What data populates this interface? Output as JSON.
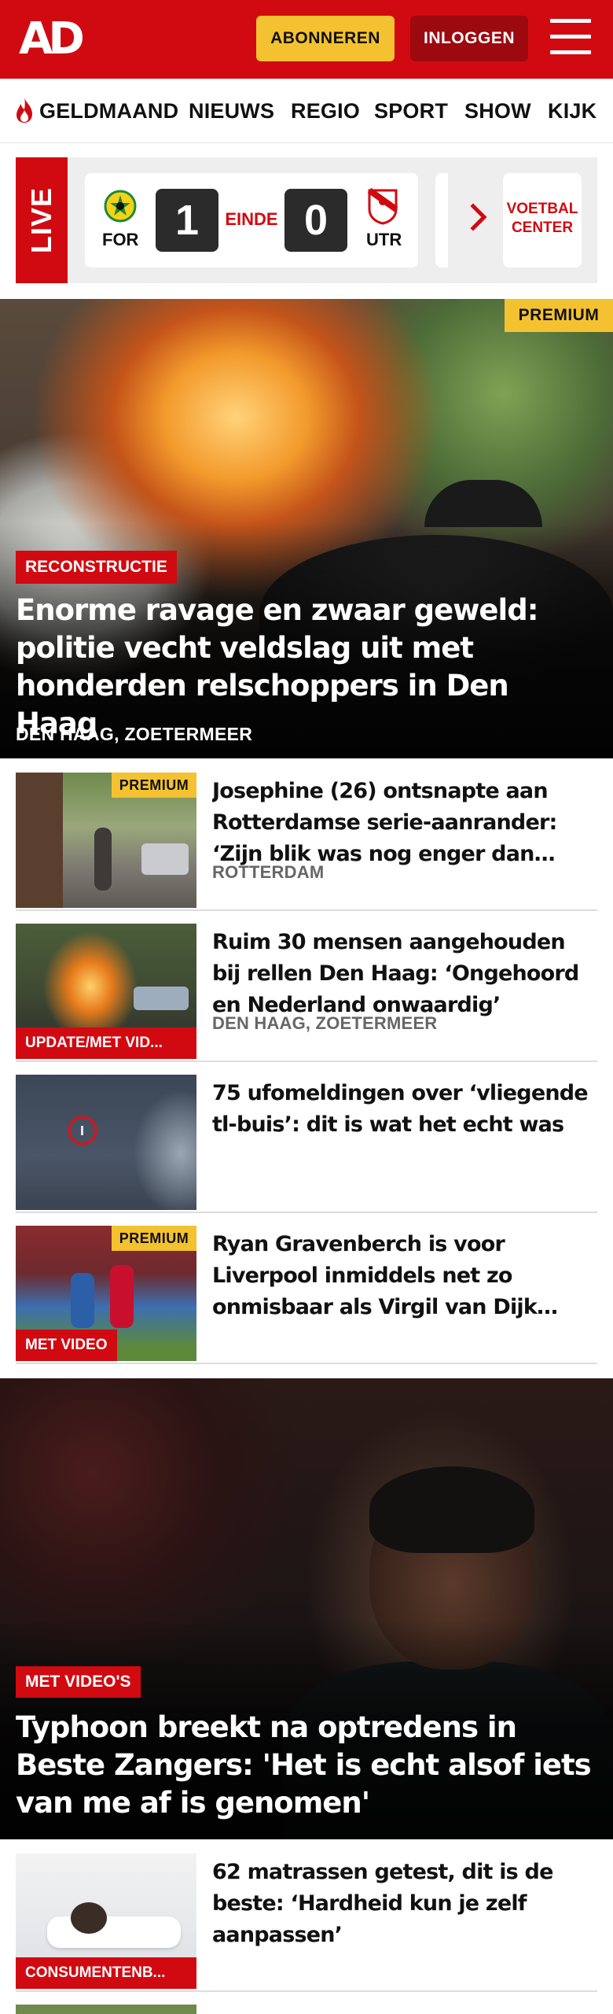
{
  "header": {
    "logo_text": "AD",
    "subscribe_label": "ABONNEREN",
    "login_label": "INLOGGEN",
    "brand_color": "#d10a11",
    "accent_color": "#f4c230"
  },
  "nav": {
    "items": [
      {
        "label": "GELDMAAND",
        "icon": "flame-icon"
      },
      {
        "label": "NIEUWS"
      },
      {
        "label": "REGIO"
      },
      {
        "label": "SPORT"
      },
      {
        "label": "SHOW"
      },
      {
        "label": "KIJK"
      }
    ]
  },
  "live": {
    "tag": "LIVE",
    "match": {
      "home_code": "FOR",
      "away_code": "UTR",
      "home_score": "1",
      "away_score": "0",
      "status": "EINDE"
    },
    "voetbal_center_line1": "VOETBAL",
    "voetbal_center_line2": "CENTER"
  },
  "hero": {
    "premium": "PREMIUM",
    "label": "RECONSTRUCTIE",
    "title": "Enorme ravage en zwaar geweld: politie vecht veldslag uit met honderden relschoppers in Den Haag",
    "location": "DEN HAAG, ZOETERMEER"
  },
  "articles": [
    {
      "title": "Josephine (26) ontsnapte aan Rotterdamse serie-aanrander: ‘Zijn blik was nog enger dan zijn…",
      "location": "ROTTERDAM",
      "premium": "PREMIUM",
      "label": ""
    },
    {
      "title": "Ruim 30 mensen aangehouden bij rellen Den Haag: ‘Ongehoord en Nederland onwaardig’",
      "location": "DEN HAAG, ZOETERMEER",
      "premium": "",
      "label": "UPDATE/MET VID..."
    },
    {
      "title": "75 ufomeldingen over ‘vliegende tl-buis’: dit is wat het echt was",
      "location": "",
      "premium": "",
      "label": ""
    },
    {
      "title": "Ryan Gravenberch is voor Liverpool inmiddels net zo onmisbaar als Virgil van Dijk en…",
      "location": "",
      "premium": "PREMIUM",
      "label": "MET VIDEO"
    }
  ],
  "video_feature": {
    "label": "MET VIDEO'S",
    "title": "Typhoon breekt na optredens in Beste Zangers: 'Het is echt alsof iets van me af is genomen'"
  },
  "articles_after": [
    {
      "title": "62 matrassen getest, dit is de beste: ‘Hardheid kun je zelf aanpassen’",
      "label": "CONSUMENTENB..."
    }
  ]
}
